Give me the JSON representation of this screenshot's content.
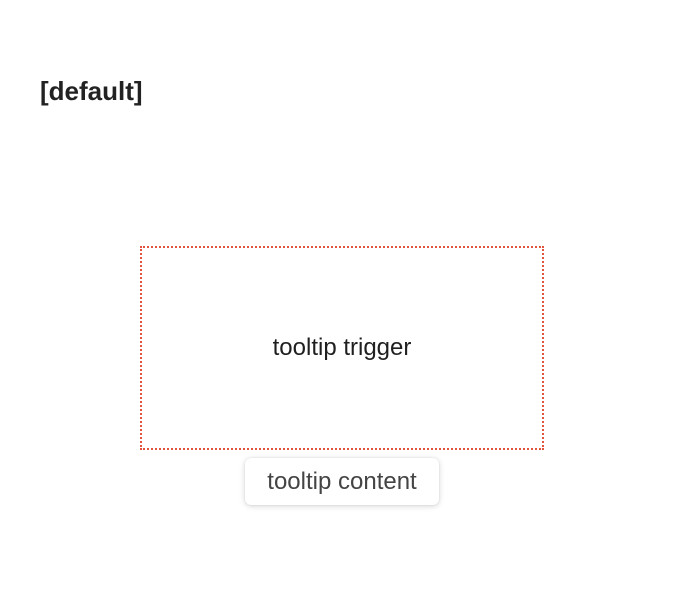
{
  "heading": "[default]",
  "trigger": {
    "label": "tooltip trigger",
    "border_color": "#e0533d"
  },
  "tooltip": {
    "content": "tooltip content"
  }
}
